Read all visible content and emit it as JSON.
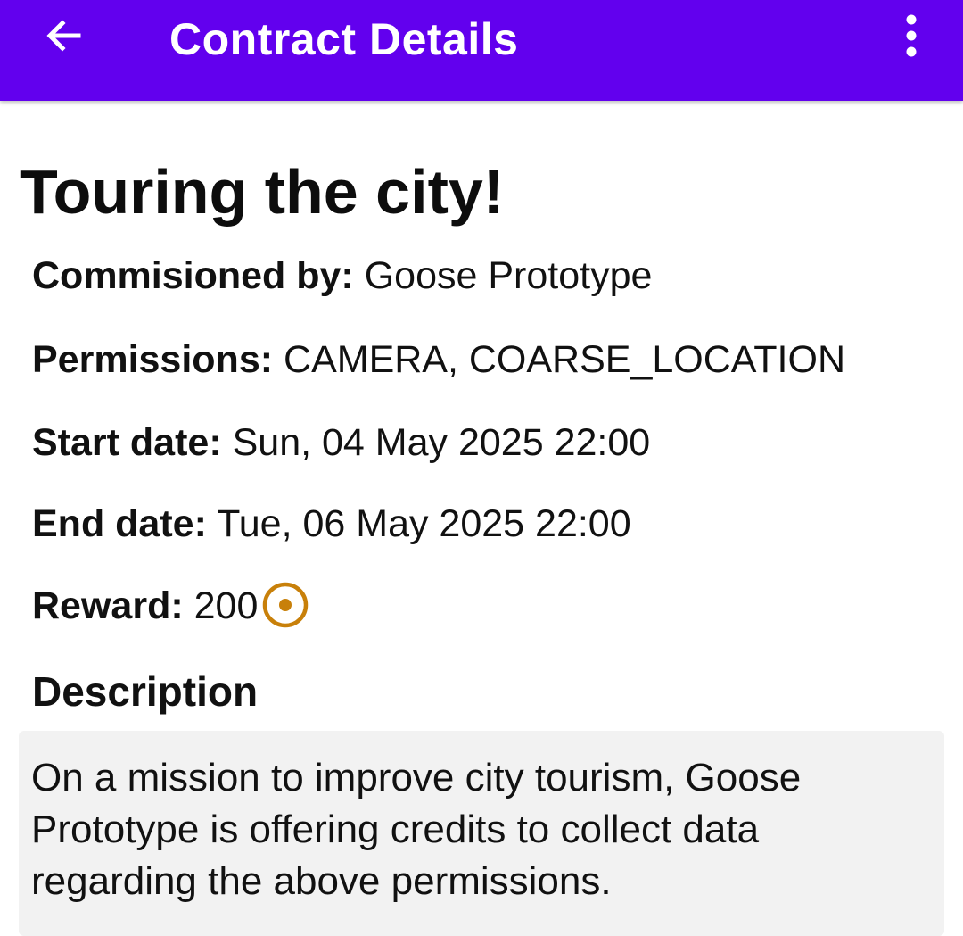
{
  "app_bar": {
    "title": "Contract Details",
    "back_icon": "arrow-left-icon",
    "menu_icon": "more-vertical-icon",
    "background_color": "#6200ee"
  },
  "contract": {
    "title": "Touring the city!",
    "fields": {
      "commissioned_by": {
        "label": "Commisioned by:",
        "value": "Goose Prototype"
      },
      "permissions": {
        "label": "Permissions:",
        "value": "CAMERA, COARSE_LOCATION"
      },
      "start_date": {
        "label": "Start date:",
        "value": "Sun, 04 May 2025 22:00"
      },
      "end_date": {
        "label": "End date:",
        "value": "Tue, 06 May 2025 22:00"
      },
      "reward": {
        "label": "Reward:",
        "value": "200",
        "icon": "coin-icon",
        "icon_color": "#c8800a"
      }
    },
    "description": {
      "heading": "Description",
      "text": "On a mission to improve city tourism, Goose Prototype is offering credits to collect data regarding the above permissions."
    }
  }
}
